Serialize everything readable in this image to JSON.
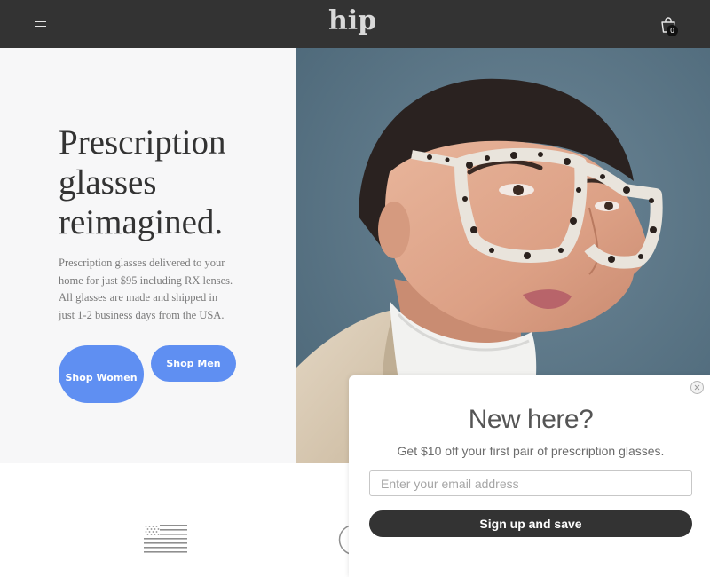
{
  "header": {
    "logo": "hip",
    "cart_count": "0"
  },
  "hero": {
    "headline": "Prescription glasses reimagined.",
    "subcopy": "Prescription glasses delivered to your home for just $95 including RX lenses. All glasses are made and shipped in just 1-2 business days from the USA.",
    "shop_women_label": "Shop Women",
    "shop_men_label": "Shop Men"
  },
  "popup": {
    "title": "New here?",
    "subtitle": "Get $10 off your first pair of prescription glasses.",
    "email_placeholder": "Enter your email address",
    "submit_label": "Sign up and save"
  },
  "colors": {
    "header_bg": "#333333",
    "accent_blue": "#5f8ff2",
    "hero_left_bg": "#f7f7f8",
    "popup_button": "#333333"
  },
  "icons": {
    "menu": "hamburger-menu-icon",
    "cart": "shopping-bag-icon",
    "flag": "us-flag-icon",
    "circle": "circle-badge-icon",
    "close": "close-icon"
  }
}
